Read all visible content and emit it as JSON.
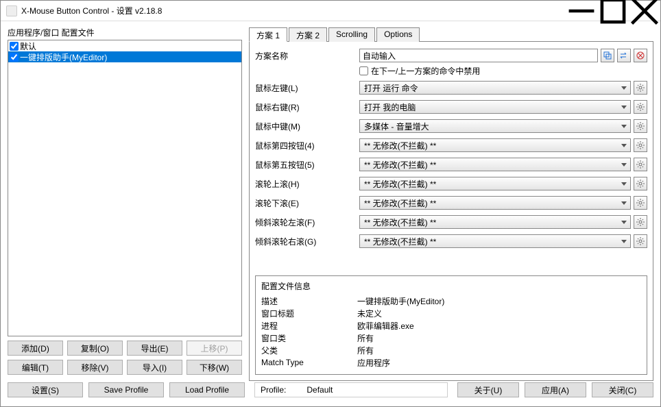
{
  "window": {
    "title": "X-Mouse Button Control - 设置 v2.18.8"
  },
  "left": {
    "label": "应用程序/窗口 配置文件",
    "profiles": [
      {
        "label": "默认",
        "checked": true,
        "selected": false
      },
      {
        "label": "一键排版助手(MyEditor)",
        "checked": true,
        "selected": true
      }
    ],
    "buttons": {
      "add": "添加(D)",
      "copy": "复制(O)",
      "export": "导出(E)",
      "moveup": "上移(P)",
      "edit": "编辑(T)",
      "remove": "移除(V)",
      "import": "导入(I)",
      "movedown": "下移(W)"
    }
  },
  "tabs": {
    "t1": "方案 1",
    "t2": "方案 2",
    "t3": "Scrolling",
    "t4": "Options"
  },
  "form": {
    "name_label": "方案名称",
    "name_value": "自动输入",
    "disable_checkbox": "在下一/上一方案的命令中禁用",
    "rows": [
      {
        "label": "鼠标左键(L)",
        "value": "打开 运行 命令"
      },
      {
        "label": "鼠标右键(R)",
        "value": "打开 我的电脑"
      },
      {
        "label": "鼠标中键(M)",
        "value": "多媒体 - 音量增大"
      },
      {
        "label": "鼠标第四按钮(4)",
        "value": "** 无修改(不拦截) **"
      },
      {
        "label": "鼠标第五按钮(5)",
        "value": "** 无修改(不拦截) **"
      },
      {
        "label": "滚轮上滚(H)",
        "value": "** 无修改(不拦截) **"
      },
      {
        "label": "滚轮下滚(E)",
        "value": "** 无修改(不拦截) **"
      },
      {
        "label": "倾斜滚轮左滚(F)",
        "value": "** 无修改(不拦截) **"
      },
      {
        "label": "倾斜滚轮右滚(G)",
        "value": "** 无修改(不拦截) **"
      }
    ]
  },
  "info": {
    "title": "配置文件信息",
    "rows": [
      {
        "label": "描述",
        "value": "一键排版助手(MyEditor)"
      },
      {
        "label": "窗口标题",
        "value": "未定义"
      },
      {
        "label": "进程",
        "value": "欧菲编辑器.exe"
      },
      {
        "label": "窗口类",
        "value": "所有"
      },
      {
        "label": "父类",
        "value": "所有"
      },
      {
        "label": "Match Type",
        "value": "应用程序"
      }
    ]
  },
  "footer": {
    "settings": "设置(S)",
    "save": "Save Profile",
    "load": "Load Profile",
    "profile_label": "Profile:",
    "profile_value": "Default",
    "about": "关于(U)",
    "apply": "应用(A)",
    "close": "关闭(C)"
  }
}
